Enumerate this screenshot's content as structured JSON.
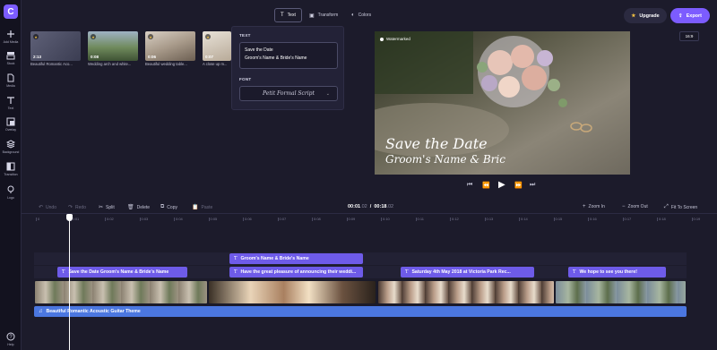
{
  "app": {
    "logo_letter": "C"
  },
  "sidebar": {
    "items": [
      {
        "label": "Add Media",
        "icon": "plus-icon"
      },
      {
        "label": "Stock",
        "icon": "stock-icon"
      },
      {
        "label": "Media",
        "icon": "media-icon"
      },
      {
        "label": "Text",
        "icon": "text-icon"
      },
      {
        "label": "Overlay",
        "icon": "overlay-icon"
      },
      {
        "label": "Background",
        "icon": "background-icon"
      },
      {
        "label": "Transition",
        "icon": "transition-icon"
      },
      {
        "label": "Logo",
        "icon": "logo-icon"
      }
    ],
    "help_label": "Help"
  },
  "media": {
    "items": [
      {
        "duration": "2:13",
        "title": "Beautiful Romantic Aco..."
      },
      {
        "duration": "0:08",
        "title": "Wedding arch and white..."
      },
      {
        "duration": "0:06",
        "title": "Beautiful wedding table..."
      },
      {
        "duration": "0:07",
        "title": "A close up m..."
      }
    ]
  },
  "toolbar": {
    "tabs": [
      {
        "label": "Text",
        "icon": "text-icon",
        "active": true
      },
      {
        "label": "Transform",
        "icon": "transform-icon",
        "active": false
      },
      {
        "label": "Colors",
        "icon": "colors-icon",
        "active": false
      }
    ],
    "upgrade_label": "Upgrade",
    "export_label": "Export",
    "ratio_label": "16:9"
  },
  "text_panel": {
    "text_heading": "TEXT",
    "text_line1": "Save the Date",
    "text_line2": "Groom's Name & Bride's Name",
    "font_heading": "FONT",
    "font_value": "Petit Formal Script"
  },
  "preview": {
    "watermark_label": "Watermarked",
    "title_text": "Save the Date",
    "subtitle_text": "Groom's Name & Bric"
  },
  "timeline": {
    "undo_label": "Undo",
    "redo_label": "Redo",
    "split_label": "Split",
    "delete_label": "Delete",
    "copy_label": "Copy",
    "paste_label": "Paste",
    "current_time": "00:01",
    "current_time_frac": ".02",
    "total_time": "00:18",
    "total_time_frac": ".02",
    "zoom_in_label": "Zoom In",
    "zoom_out_label": "Zoom Out",
    "fit_label": "Fit To Screen",
    "ruler": [
      "0",
      "0:01",
      "0:02",
      "0:03",
      "0:04",
      "0:05",
      "0:06",
      "0:07",
      "0:08",
      "0:09",
      "0:10",
      "0:11",
      "0:12",
      "0:13",
      "0:14",
      "0:15",
      "0:16",
      "0:17",
      "0:18",
      "0:19",
      "0:20"
    ],
    "text_clips_row1": [
      {
        "label": "Groom's Name & Bride's Name"
      }
    ],
    "text_clips_row2": [
      {
        "label": "Save the Date Groom's Name & Bride's Name"
      },
      {
        "label": "Have the great pleasure of announcing their weddi..."
      },
      {
        "label": "Saturday 4th May 2018 at Victoria Park Rec..."
      },
      {
        "label": "We hope to see you there!"
      }
    ],
    "audio_label": "Beautiful Romantic Acoustic Guitar Theme"
  }
}
